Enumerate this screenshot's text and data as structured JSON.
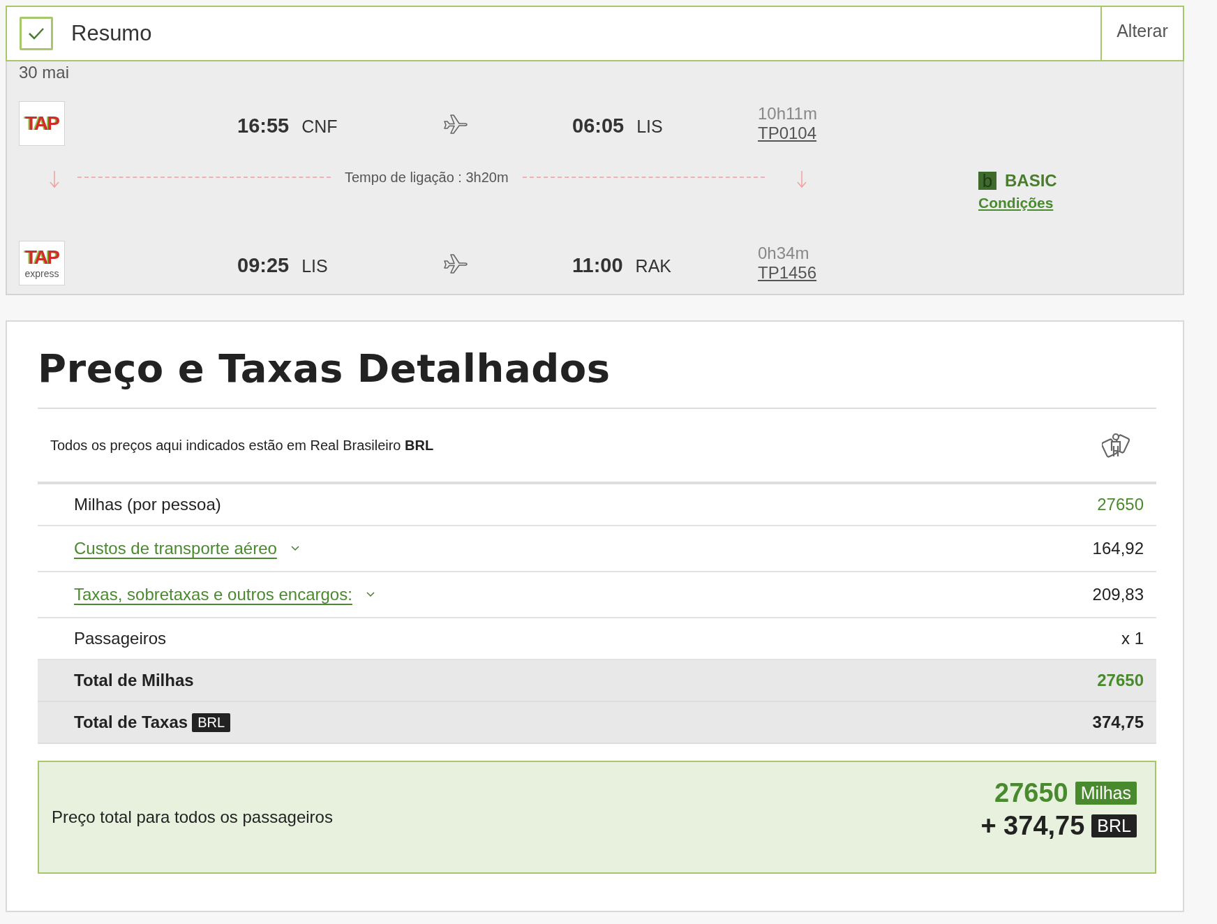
{
  "summary": {
    "checked": true,
    "title": "Resumo",
    "change_button": "Alterar"
  },
  "date": "30 mai",
  "flights": [
    {
      "logo": "TAP",
      "dep_time": "16:55",
      "dep_airport": "CNF",
      "arr_time": "06:05",
      "arr_airport": "LIS",
      "duration": "10h11m",
      "flight_number": "TP0104"
    },
    {
      "logo": "TAP",
      "logo_sub": "express",
      "dep_time": "09:25",
      "dep_airport": "LIS",
      "arr_time": "11:00",
      "arr_airport": "RAK",
      "duration": "0h34m",
      "flight_number": "TP1456"
    }
  ],
  "connection": {
    "label": "Tempo de ligação : 3h20m"
  },
  "fare": {
    "badge": "b",
    "name": "BASIC",
    "link": "Condições"
  },
  "price": {
    "title": "Preço e Taxas Detalhados",
    "currency_note": "Todos os preços aqui indicados estão em Real Brasileiro **BRL**",
    "rows": [
      {
        "kind": "miles",
        "label": "Milhas (por pessoa)",
        "value": "27650"
      },
      {
        "kind": "expandable",
        "expanded": false,
        "label": "Custos de transporte aéreo",
        "value": "164,92"
      },
      {
        "kind": "expandable",
        "expanded": false,
        "label": "Taxas, sobretaxas e outros encargos:",
        "value": "209,83"
      },
      {
        "kind": "plain",
        "label": "Passageiros",
        "value": "x 1"
      },
      {
        "kind": "total_miles",
        "label": "Total de Milhas",
        "value": "27650"
      },
      {
        "kind": "total",
        "label": "Total de Taxas",
        "tag": "BRL",
        "value": "374,75"
      }
    ],
    "grand_total": {
      "label": "Preço total para todos os passageiros",
      "miles": "27650",
      "miles_unit": "Milhas",
      "amount": "+ 374,75",
      "currency": "BRL"
    }
  }
}
